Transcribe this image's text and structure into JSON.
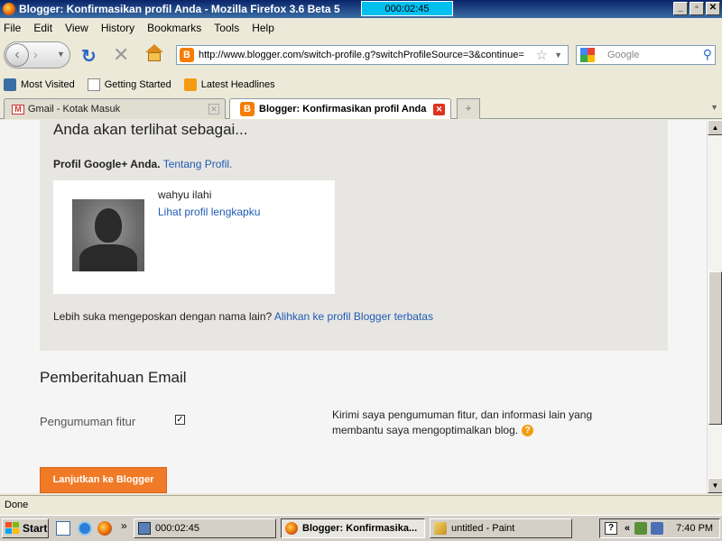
{
  "window": {
    "title": "Blogger: Konfirmasikan profil Anda - Mozilla Firefox 3.6 Beta 5",
    "timer": "000:02:45",
    "minimize": "_",
    "maximize": "▫",
    "close": "✕"
  },
  "menu": [
    "File",
    "Edit",
    "View",
    "History",
    "Bookmarks",
    "Tools",
    "Help"
  ],
  "nav": {
    "url": "http://www.blogger.com/switch-profile.g?switchProfileSource=3&continue=",
    "search_placeholder": "Google"
  },
  "bookmarks": [
    "Most Visited",
    "Getting Started",
    "Latest Headlines"
  ],
  "tabs": [
    {
      "label": "Gmail - Kotak Masuk",
      "active": false
    },
    {
      "label": "Blogger: Konfirmasikan profil Anda",
      "active": true
    }
  ],
  "page": {
    "heading": "Anda akan terlihat sebagai...",
    "profile_label": "Profil Google+ Anda.",
    "profile_link": "Tentang Profil.",
    "user_name": "wahyu ilahi",
    "view_profile_link": "Lihat profil lengkapku",
    "prefer_text": "Lebih suka mengeposkan dengan nama lain?",
    "switch_link": "Alihkan ke profil Blogger terbatas",
    "email_heading": "Pemberitahuan Email",
    "feature_label": "Pengumuman fitur",
    "feature_checked": true,
    "feature_desc": "Kirimi saya pengumuman fitur, dan informasi lain yang membantu saya mengoptimalkan blog.",
    "continue_button": "Lanjutkan ke Blogger"
  },
  "status": "Done",
  "taskbar": {
    "start": "Start",
    "tasks": [
      "000:02:45",
      "Blogger: Konfirmasika...",
      "untitled - Paint"
    ],
    "clock": "7:40 PM"
  },
  "colors": {
    "accent_orange": "#f07a26",
    "link_blue": "#1f5bb5"
  }
}
